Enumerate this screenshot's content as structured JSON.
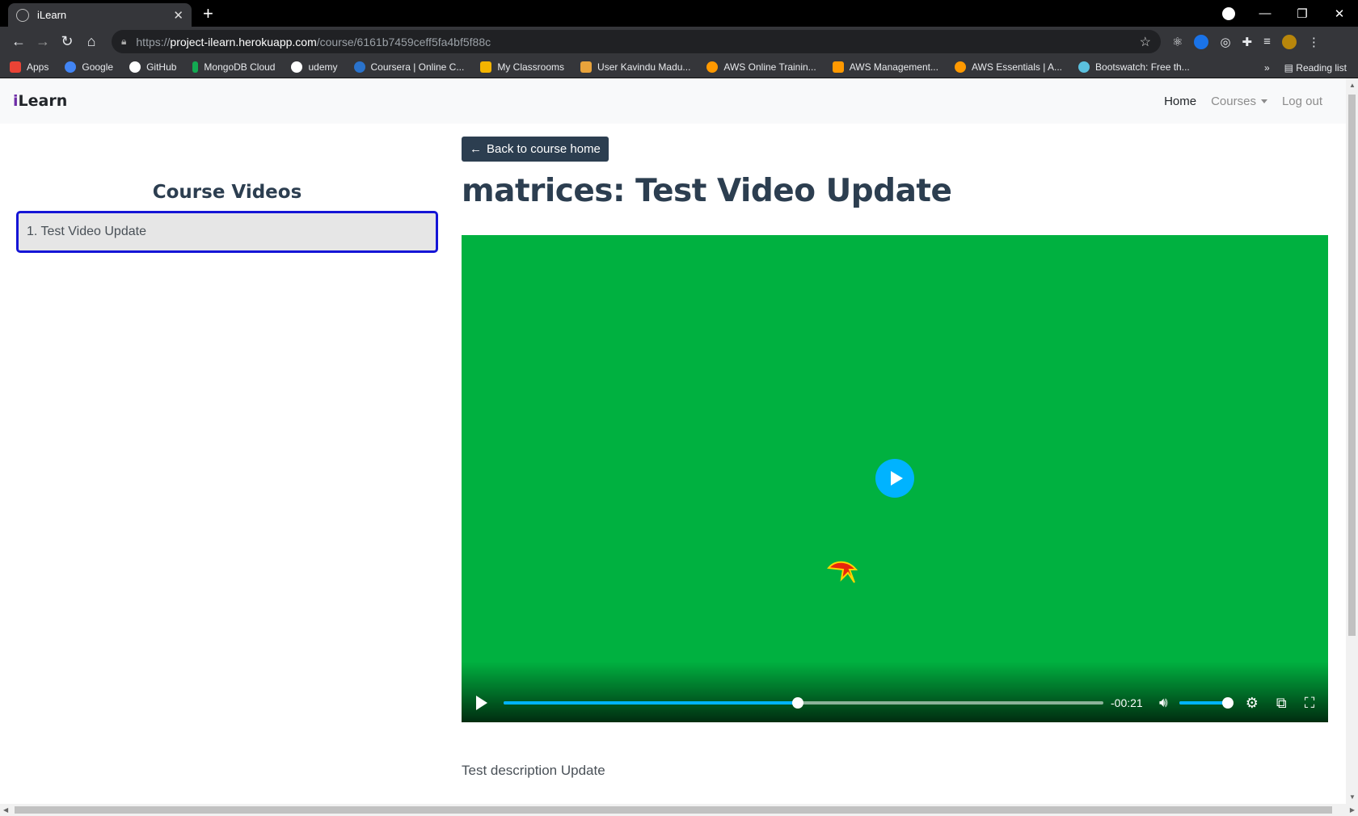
{
  "browser": {
    "tab_title": "iLearn",
    "url_domain": "project-ilearn.herokuapp.com",
    "url_prefix": "https://",
    "url_path": "/course/6161b7459ceff5fa4bf5f88c",
    "bookmarks": [
      {
        "label": "Apps",
        "color": "#ea4335"
      },
      {
        "label": "Google",
        "color": "#4285f4"
      },
      {
        "label": "GitHub",
        "color": "#ffffff"
      },
      {
        "label": "MongoDB Cloud",
        "color": "#13aa52"
      },
      {
        "label": "udemy",
        "color": "#ffffff"
      },
      {
        "label": "Coursera | Online C...",
        "color": "#2a73cc"
      },
      {
        "label": "My Classrooms",
        "color": "#f4b400"
      },
      {
        "label": "User Kavindu Madu...",
        "color": "#e8a33b"
      },
      {
        "label": "AWS Online Trainin...",
        "color": "#ff9900"
      },
      {
        "label": "AWS Management...",
        "color": "#ff9900"
      },
      {
        "label": "AWS Essentials | A...",
        "color": "#ff9900"
      },
      {
        "label": "Bootswatch: Free th...",
        "color": "#5bc0de"
      }
    ],
    "reading_list": "Reading list"
  },
  "navbar": {
    "brand_i": "i",
    "brand_rest": "Learn",
    "home": "Home",
    "courses": "Courses",
    "logout": "Log out"
  },
  "sidebar": {
    "title": "Course Videos",
    "items": [
      {
        "label": "1. Test Video Update"
      }
    ]
  },
  "main": {
    "back_button": "Back to course home",
    "title": "matrices: Test Video Update",
    "description": "Test description Update"
  },
  "player": {
    "background": "#00b140",
    "accent": "#00b3ff",
    "time_remaining": "-00:21",
    "progress_percent": 49,
    "volume_percent": 100
  }
}
